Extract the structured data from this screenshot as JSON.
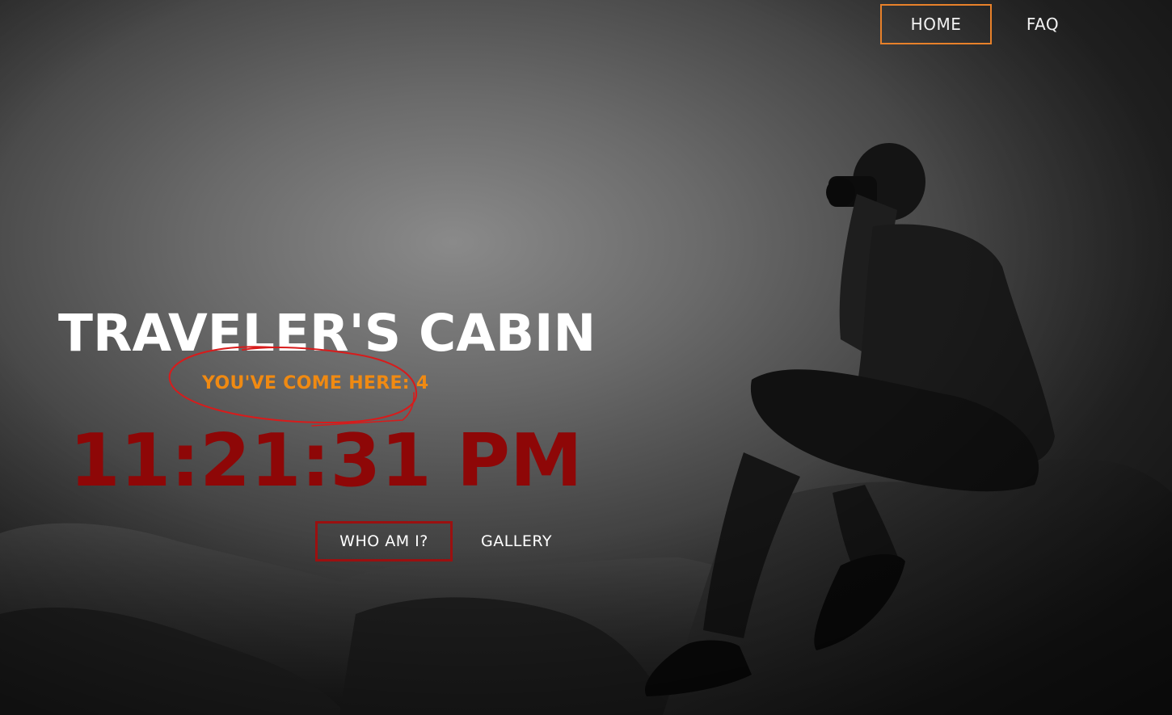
{
  "nav": {
    "home_label": "HOME",
    "faq_label": "FAQ"
  },
  "hero": {
    "title": "TRAVELER'S CABIN",
    "visits_text": "YOU'VE COME HERE: 4",
    "clock_text": "11:21:31 PM"
  },
  "actions": {
    "who_label": "WHO AM I?",
    "gallery_label": "GALLERY"
  },
  "colors": {
    "accent_orange": "#e8812a",
    "visits_orange": "#f08a12",
    "clock_red": "#8e0707",
    "button_border_red": "#9b1010",
    "annotation_red": "#d81b1b"
  }
}
